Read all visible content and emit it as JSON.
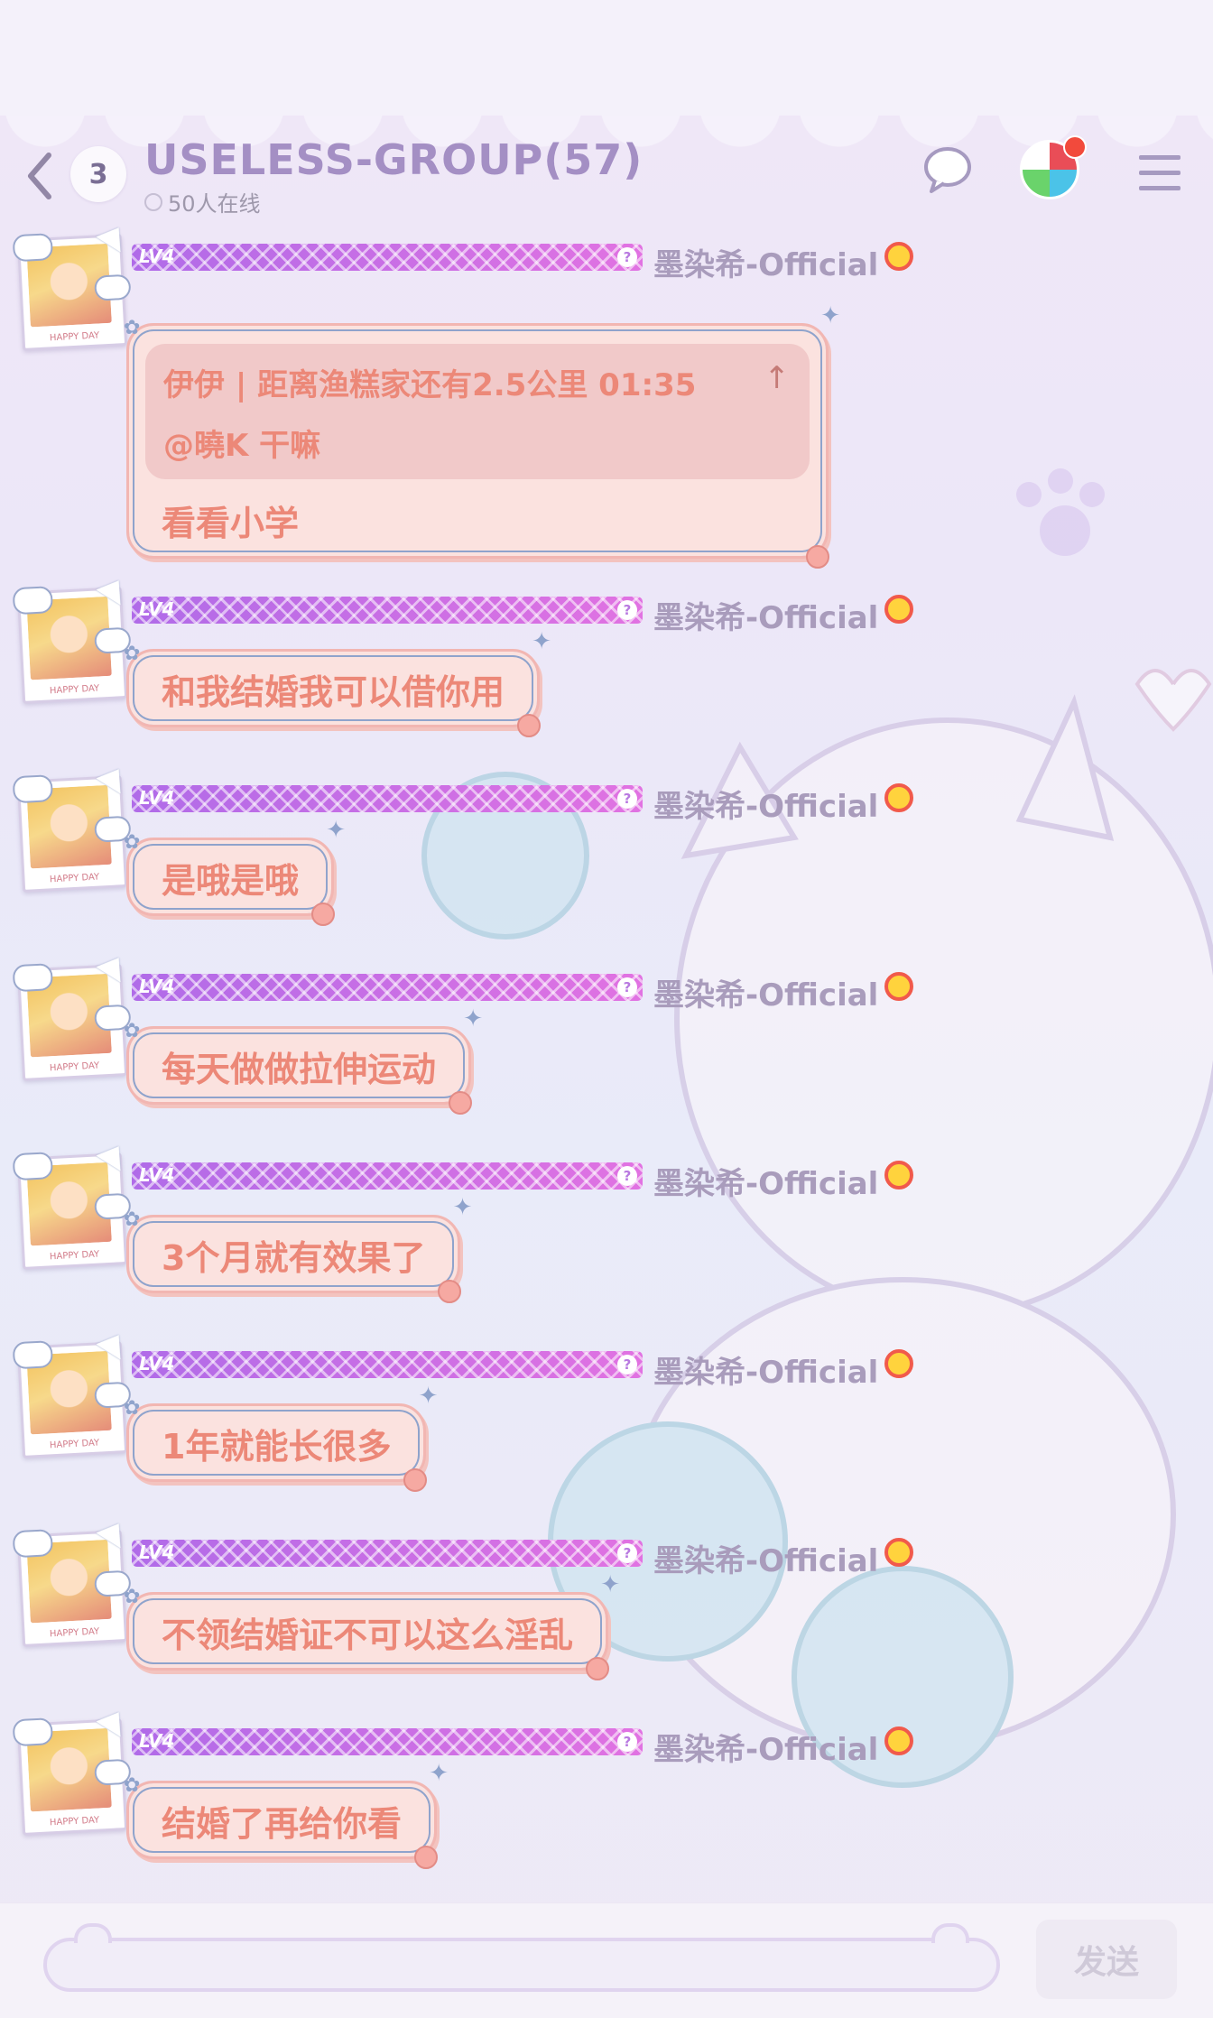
{
  "header": {
    "unread_count": "3",
    "title": "USELESS-GROUP(57)",
    "online_text": "50人在线"
  },
  "messages": [
    {
      "level": "LV4",
      "username": "墨染希-Official",
      "quote": {
        "text": "伊伊 | 距离渔糕家还有2.5公里 01:35",
        "mention": "@曉K 干嘛"
      },
      "text": "看看小学"
    },
    {
      "level": "LV4",
      "username": "墨染希-Official",
      "text": "和我结婚我可以借你用"
    },
    {
      "level": "LV4",
      "username": "墨染希-Official",
      "text": "是哦是哦"
    },
    {
      "level": "LV4",
      "username": "墨染希-Official",
      "text": "每天做做拉伸运动"
    },
    {
      "level": "LV4",
      "username": "墨染希-Official",
      "text": "3个月就有效果了"
    },
    {
      "level": "LV4",
      "username": "墨染希-Official",
      "text": "1年就能长很多"
    },
    {
      "level": "LV4",
      "username": "墨染希-Official",
      "text": "不领结婚证不可以这么淫乱"
    },
    {
      "level": "LV4",
      "username": "墨染希-Official",
      "text": "结婚了再给你看"
    }
  ],
  "avatar_caption": "HAPPY DAY",
  "input": {
    "placeholder": "",
    "send_label": "发送"
  },
  "icons": {
    "back": "chevron-left-icon",
    "chat": "chat-bubble-icon",
    "menu": "hamburger-menu-icon",
    "quote_up": "arrow-up-icon",
    "level_help": "question-icon",
    "emoji": "smiley-face-icon"
  },
  "colors": {
    "title": "#a48fc4",
    "bubble_bg": "#fbe2df",
    "bubble_text": "#ec8878",
    "level_bar": "#c070e6",
    "username": "#a99cbc"
  }
}
